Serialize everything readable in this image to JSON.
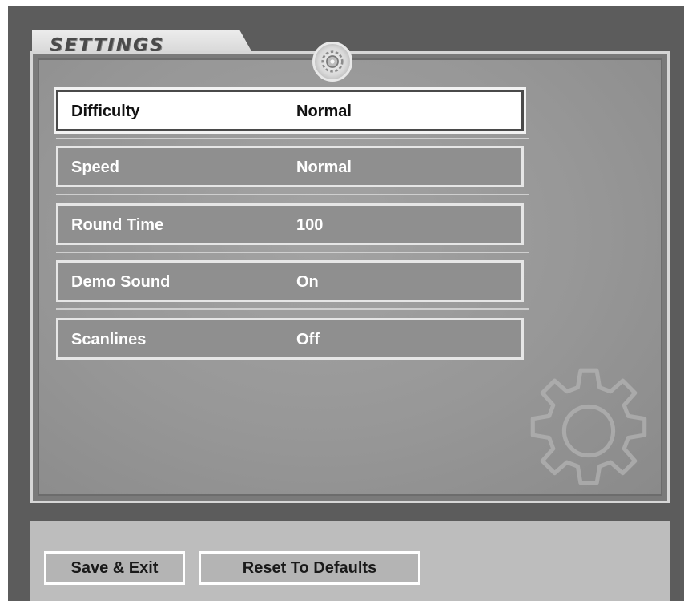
{
  "window": {
    "title": "SETTINGS"
  },
  "colors": {
    "frame": "#5c5c5c",
    "panel": "#979797",
    "row_border": "#e6e6e6",
    "selected_row": "#ffffff",
    "bottom_bar": "#bdbdbd"
  },
  "settings": [
    {
      "label": "Difficulty",
      "value": "Normal",
      "selected": true
    },
    {
      "label": "Speed",
      "value": "Normal",
      "selected": false
    },
    {
      "label": "Round Time",
      "value": "100",
      "selected": false
    },
    {
      "label": "Demo Sound",
      "value": "On",
      "selected": false
    },
    {
      "label": "Scanlines",
      "value": "Off",
      "selected": false
    }
  ],
  "buttons": {
    "save_exit": "Save & Exit",
    "reset": "Reset To Defaults"
  },
  "icons": {
    "badge": "gear-icon",
    "background": "gear-outline-icon"
  }
}
